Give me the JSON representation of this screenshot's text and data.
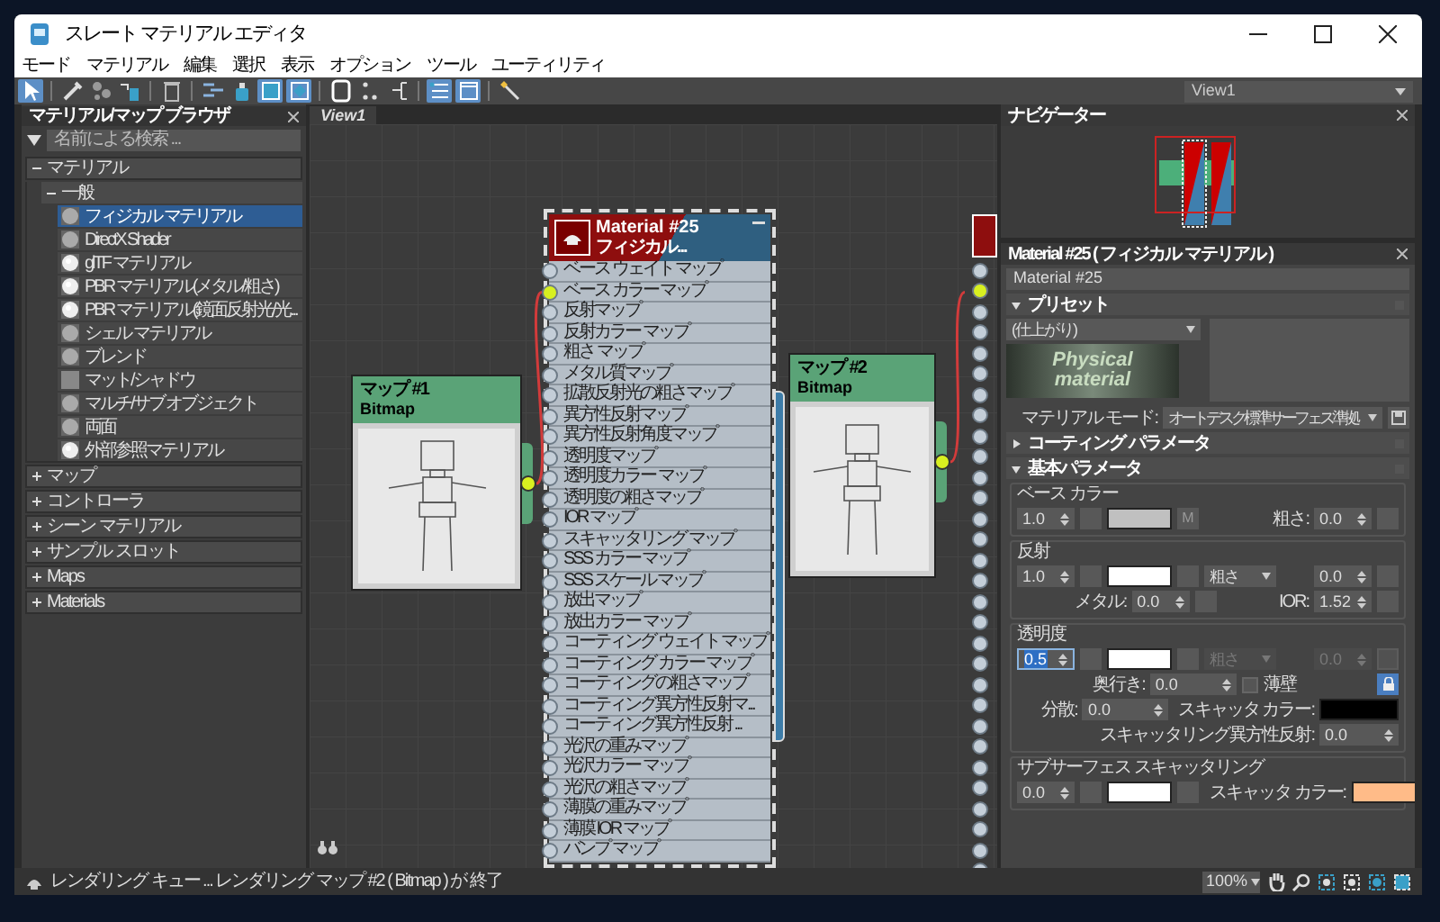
{
  "window": {
    "title": "スレート マテリアル エディタ"
  },
  "menu": [
    "モード",
    "マテリアル",
    "編集",
    "選択",
    "表示",
    "オプション",
    "ツール",
    "ユーティリティ"
  ],
  "toolbar": [
    {
      "kind": "cursor",
      "selected": true
    },
    {
      "kind": "separator"
    },
    {
      "kind": "eyedropper",
      "selected": false
    },
    {
      "kind": "nodes",
      "selected": false
    },
    {
      "kind": "put",
      "selected": false
    },
    {
      "kind": "separator"
    },
    {
      "kind": "trash",
      "selected": false
    },
    {
      "kind": "separator"
    },
    {
      "kind": "layout",
      "selected": false
    },
    {
      "kind": "bottle",
      "selected": false
    },
    {
      "kind": "fit",
      "selected": true
    },
    {
      "kind": "fitsel",
      "selected": true
    },
    {
      "kind": "separator"
    },
    {
      "kind": "square",
      "selected": false
    },
    {
      "kind": "dots",
      "selected": false
    },
    {
      "kind": "tree",
      "selected": false
    },
    {
      "kind": "separator"
    },
    {
      "kind": "list",
      "selected": true
    },
    {
      "kind": "image",
      "selected": true
    },
    {
      "kind": "separator"
    },
    {
      "kind": "wand",
      "selected": false
    }
  ],
  "view_select": "View1",
  "browser": {
    "title": "マテリアル/マップ ブラウザ",
    "search_placeholder": "名前による検索 ...",
    "groups": [
      {
        "label": "マテリアル",
        "expanded": true,
        "children": [
          {
            "label": "一般",
            "expanded": true,
            "children": [
              {
                "label": "フィジカル マテリアル",
                "kind": "dull",
                "selected": true
              },
              {
                "label": "DirectX Shader",
                "kind": "dull",
                "selected": false
              },
              {
                "label": "glTF マテリアル",
                "kind": "glossy",
                "selected": false
              },
              {
                "label": "PBR マテリアル(メタル/粗さ)",
                "kind": "glossy",
                "selected": false
              },
              {
                "label": "PBR マテリアル(鏡面反射光/光...",
                "kind": "glossy",
                "selected": false
              },
              {
                "label": "シェル マテリアル",
                "kind": "dull",
                "selected": false
              },
              {
                "label": "ブレンド",
                "kind": "dull",
                "selected": false
              },
              {
                "label": "マット/シャドウ",
                "kind": "flat",
                "selected": false
              },
              {
                "label": "マルチ/サブ オブジェクト",
                "kind": "dull",
                "selected": false
              },
              {
                "label": "両面",
                "kind": "dull",
                "selected": false
              },
              {
                "label": "外部参照マテリアル",
                "kind": "glossy",
                "selected": false
              }
            ]
          }
        ]
      },
      {
        "label": "マップ",
        "expanded": false
      },
      {
        "label": "コントローラ",
        "expanded": false
      },
      {
        "label": "シーン マテリアル",
        "expanded": false
      },
      {
        "label": "サンプル スロット",
        "expanded": false
      },
      {
        "label": "Maps",
        "expanded": false
      },
      {
        "label": "Materials",
        "expanded": false
      }
    ]
  },
  "canvas": {
    "tab": "View1",
    "nodes": [
      {
        "kind": "map",
        "title": "マップ #1",
        "subtitle": "Bitmap",
        "selected": false,
        "connected": true
      },
      {
        "kind": "material",
        "title": "Material #25",
        "subtitle": "フィジカル...",
        "selected": true,
        "slots": [
          {
            "label": "ベース ウェイト マップ",
            "connected": false
          },
          {
            "label": "ベース カラー マップ",
            "connected": true
          },
          {
            "label": "反射マップ",
            "connected": false
          },
          {
            "label": "反射カラー マップ",
            "connected": false
          },
          {
            "label": "粗さ マップ",
            "connected": false
          },
          {
            "label": "メタル質マップ",
            "connected": false
          },
          {
            "label": "拡散反射光の粗さマップ",
            "connected": false
          },
          {
            "label": "異方性反射マップ",
            "connected": false
          },
          {
            "label": "異方性反射角度マップ",
            "connected": false
          },
          {
            "label": "透明度マップ",
            "connected": false
          },
          {
            "label": "透明度カラー マップ",
            "connected": false
          },
          {
            "label": "透明度の粗さマップ",
            "connected": false
          },
          {
            "label": "IOR マップ",
            "connected": false
          },
          {
            "label": "スキャッタリング マップ",
            "connected": false
          },
          {
            "label": "SSS カラー マップ",
            "connected": false
          },
          {
            "label": "SSS スケール マップ",
            "connected": false
          },
          {
            "label": "放出マップ",
            "connected": false
          },
          {
            "label": "放出カラー マップ",
            "connected": false
          },
          {
            "label": "コーティング ウェイト マップ",
            "connected": false
          },
          {
            "label": "コーティング カラー マップ",
            "connected": false
          },
          {
            "label": "コーティングの粗さマップ",
            "connected": false
          },
          {
            "label": "コーティング異方性反射マ...",
            "connected": false
          },
          {
            "label": "コーティング異方性反射 ...",
            "connected": false
          },
          {
            "label": "光沢の重みマップ",
            "connected": false
          },
          {
            "label": "光沢カラー マップ",
            "connected": false
          },
          {
            "label": "光沢の粗さマップ",
            "connected": false
          },
          {
            "label": "薄膜の重みマップ",
            "connected": false
          },
          {
            "label": "薄膜 IOR マップ",
            "connected": false
          },
          {
            "label": "バンプ マップ",
            "connected": false
          }
        ]
      },
      {
        "kind": "map",
        "title": "マップ #2",
        "subtitle": "Bitmap",
        "selected": false,
        "connected": true
      },
      {
        "kind": "edge"
      }
    ]
  },
  "navigator": {
    "title": "ナビゲーター"
  },
  "params": {
    "title": "Material #25 ( フィジカル マテリアル )",
    "name": "Material #25",
    "preset": {
      "label": "プリセット",
      "expanded": true,
      "value": "(仕上がり)",
      "logo": [
        "Physical",
        "material"
      ],
      "mode_label": "マテリアル モード:",
      "mode": "オートデスク標準サーフェス準拠"
    },
    "coating": {
      "label": "コーティング パラメータ",
      "expanded": false
    },
    "basic": {
      "label": "基本パラメータ",
      "expanded": true,
      "base": {
        "label": "ベース カラー",
        "weight": "1.0",
        "color": "#c0c0c0",
        "map_label": "M",
        "rough_label": "粗さ:",
        "roughness": "0.0"
      },
      "reflection": {
        "label": "反射",
        "weight": "1.0",
        "color": "#ffffff",
        "mode": "粗さ",
        "roughness": "0.0",
        "metal_label": "メタル:",
        "metalness": "0.0",
        "ior_label": "IOR:",
        "ior": "1.52"
      },
      "transparency": {
        "label": "透明度",
        "weight": "0.5",
        "weight_selected": true,
        "color": "#ffffff",
        "mode": "粗さ",
        "disabled": true,
        "roughness": "0.0",
        "depth_label": "奥行き:",
        "depth": "0.0",
        "thin_label": "薄壁",
        "thin_walled": false,
        "locked": true,
        "dispersion_label": "分散:",
        "dispersion": "0.0",
        "scatter": {
          "label": "スキャッタ カラー:",
          "color": "#000000"
        },
        "aniso_label": "スキャッタリング異方性反射:",
        "aniso": "0.0"
      },
      "sss": {
        "label": "サブサーフェス スキャッタリング",
        "weight": "0.0",
        "color": "#ffffff",
        "scatter": {
          "label": "スキャッタ カラー:",
          "color": "#ffbb88"
        }
      }
    }
  },
  "status_bar": {
    "text": "レンダリング キュー ... レンダリング マップ #2 ( Bitmap ) が 終了",
    "zoom": "100%"
  }
}
